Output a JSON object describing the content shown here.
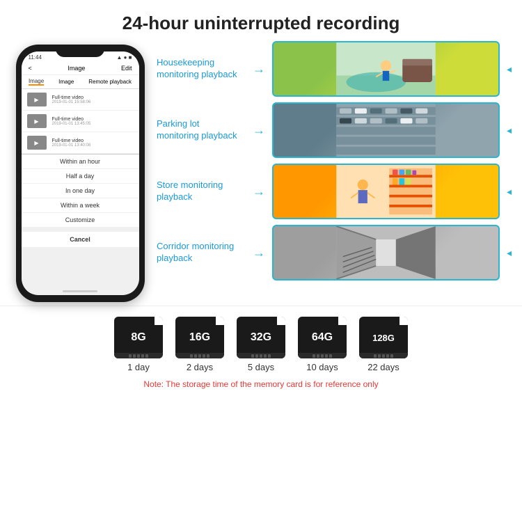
{
  "header": {
    "title": "24-hour uninterrupted recording"
  },
  "phone": {
    "status_time": "11:44",
    "nav_back": "<",
    "nav_title": "Image",
    "nav_edit": "Edit",
    "tabs": [
      "Image",
      "Image",
      "Remote playback"
    ],
    "videos": [
      {
        "title": "Full-time video",
        "date": "2019-01-01 15:58:06"
      },
      {
        "title": "Full-time video",
        "date": "2019-01-01 13:45:05"
      },
      {
        "title": "Full-time video",
        "date": "2019-01-01 13:40:08"
      }
    ],
    "dropdown_items": [
      "Within an hour",
      "Half a day",
      "In one day",
      "Within a week",
      "Customize"
    ],
    "cancel_label": "Cancel"
  },
  "monitoring": [
    {
      "label": "Housekeeping\nmonitoring playback",
      "img_alt": "housekeeping"
    },
    {
      "label": "Parking lot\nmonitoring playback",
      "img_alt": "parking lot"
    },
    {
      "label": "Store monitoring\nplayback",
      "img_alt": "store"
    },
    {
      "label": "Corridor monitoring\nplayback",
      "img_alt": "corridor"
    }
  ],
  "sdcards": [
    {
      "size": "8G",
      "days": "1 day"
    },
    {
      "size": "16G",
      "days": "2 days"
    },
    {
      "size": "32G",
      "days": "5 days"
    },
    {
      "size": "64G",
      "days": "10 days"
    },
    {
      "size": "128G",
      "days": "22 days"
    }
  ],
  "note": "Note: The storage time of the memory card is for reference only"
}
